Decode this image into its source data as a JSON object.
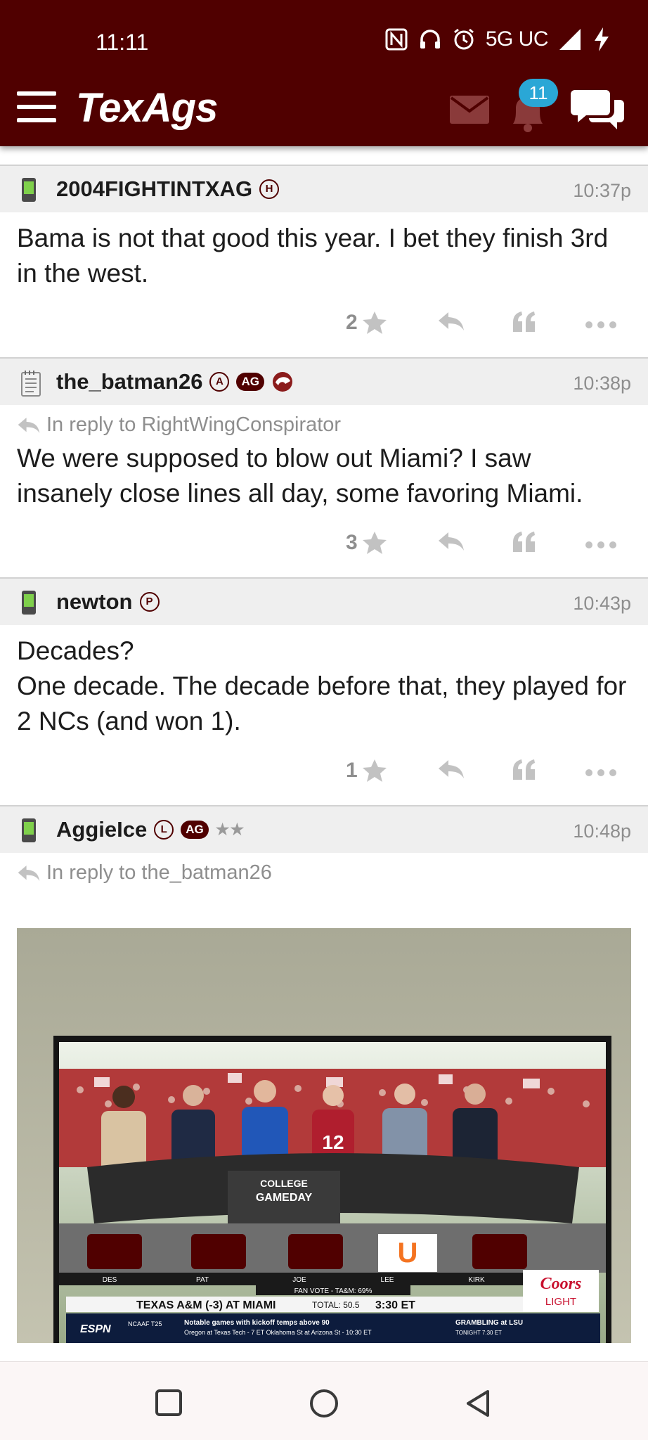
{
  "status_bar": {
    "time": "11:11",
    "network": "5G UC"
  },
  "header": {
    "logo": "TexAgs",
    "notification_count": "11"
  },
  "posts": [
    {
      "user": "2004FIGHTINTXAG",
      "badges": [
        "H"
      ],
      "time": "10:37p",
      "reply_to": "",
      "body": "Bama is not that good this year. I bet they finish 3rd in the west.",
      "stars": "2",
      "device": "phone"
    },
    {
      "user": "the_batman26",
      "badges": [
        "A",
        "AG"
      ],
      "time": "10:38p",
      "reply_to": "In reply to RightWingConspirator",
      "body": "We were supposed to blow out Miami? I saw insanely close lines all day, some favoring Miami.",
      "stars": "3",
      "device": "notepad"
    },
    {
      "user": "newton",
      "badges": [
        "P"
      ],
      "time": "10:43p",
      "reply_to": "",
      "body_lines": [
        "Decades?",
        "One decade. The decade before that, they played for 2 NCs (and won 1)."
      ],
      "stars": "1",
      "device": "phone"
    },
    {
      "user": "AggieIce",
      "badges": [
        "L",
        "AG"
      ],
      "rank_stars": "★★",
      "time": "10:48p",
      "reply_to": "In reply to the_batman26",
      "device": "phone"
    }
  ],
  "photo": {
    "desk_title_1": "COLLEGE",
    "desk_title_2": "GAMEDAY",
    "names": [
      "DES",
      "PAT",
      "JOE",
      "LEE",
      "KIRK"
    ],
    "fan_vote": "FAN VOTE - TA&M: 69%",
    "matchup": "TEXAS A&M (-3) AT MIAMI",
    "total": "TOTAL: 50.5",
    "kick": "3:30 ET",
    "network": "ESPN",
    "ticker_tag": "NCAAF T25",
    "ticker_line1": "Notable games with kickoff temps above 90",
    "ticker_line2": "Oregon at Texas Tech - 7 ET   Oklahoma St at Arizona St - 10:30 ET",
    "ticker_right1": "GRAMBLING at LSU",
    "ticker_right2": "TONIGHT 7:30 ET",
    "sponsor1": "Coors",
    "sponsor2": "LIGHT",
    "jersey_number": "12",
    "midfield_letter": "U"
  },
  "colors": {
    "maroon": "#500000",
    "badge_blue": "#2aa7d6",
    "muted": "#8e8e8e"
  }
}
